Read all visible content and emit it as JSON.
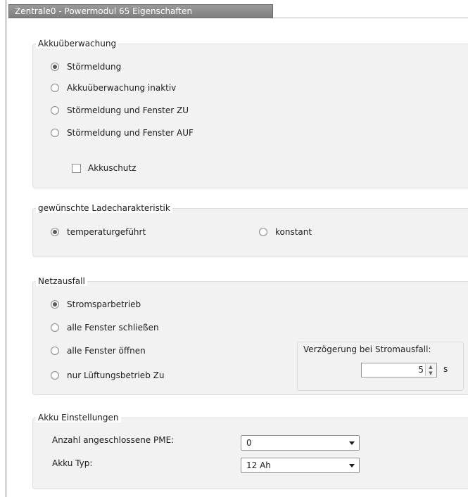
{
  "window": {
    "title": "Zentrale0 - Powermodul 65 Eigenschaften"
  },
  "akku_ueberwachung": {
    "title": "Akkuüberwachung",
    "options": [
      {
        "label": "Störmeldung",
        "checked": true
      },
      {
        "label": "Akkuüberwachung inaktiv",
        "checked": false
      },
      {
        "label": "Störmeldung und Fenster ZU",
        "checked": false
      },
      {
        "label": "Störmeldung und Fenster AUF",
        "checked": false
      }
    ],
    "checkbox": {
      "label": "Akkuschutz",
      "checked": false
    }
  },
  "ladecharakteristik": {
    "title": "gewünschte Ladecharakteristik",
    "options": [
      {
        "label": "temperaturgeführt",
        "checked": true
      },
      {
        "label": "konstant",
        "checked": false
      }
    ]
  },
  "netzausfall": {
    "title": "Netzausfall",
    "options": [
      {
        "label": "Stromsparbetrieb",
        "checked": true
      },
      {
        "label": "alle Fenster schließen",
        "checked": false
      },
      {
        "label": "alle Fenster öffnen",
        "checked": false
      },
      {
        "label": "nur Lüftungsbetrieb Zu",
        "checked": false
      }
    ],
    "delay": {
      "title": "Verzögerung bei Stromausfall:",
      "value": "5",
      "unit": "s"
    }
  },
  "akku_einstellungen": {
    "title": "Akku Einstellungen",
    "pme_label": "Anzahl angeschlossene PME:",
    "pme_value": "0",
    "typ_label": "Akku Typ:",
    "typ_value": "12 Ah"
  },
  "icons": {
    "spin_up": "▲",
    "spin_down": "▼"
  }
}
